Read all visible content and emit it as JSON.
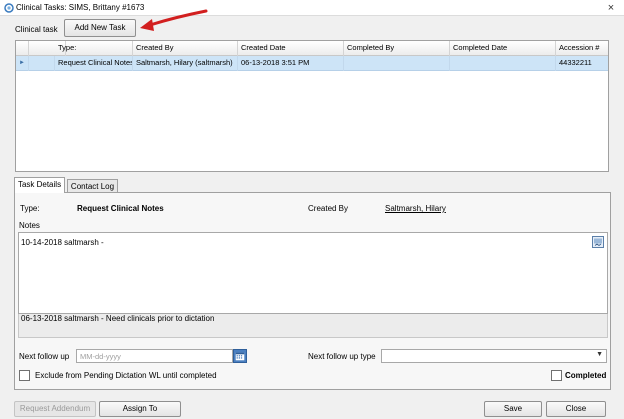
{
  "window": {
    "title": "Clinical Tasks: SIMS,  Brittany #1673",
    "close_glyph": "×"
  },
  "header": {
    "clinical_task_label": "Clinical task",
    "add_task_label": "Add New Task"
  },
  "grid": {
    "columns": [
      "",
      "Type:",
      "Created By",
      "Created Date",
      "Completed By",
      "Completed Date",
      "Accession #"
    ],
    "rows": [
      {
        "indicator": "►",
        "type": "Request Clinical Notes",
        "created_by": "Saltmarsh, Hilary (saltmarsh)",
        "created_date": "06-13-2018 3:51 PM",
        "completed_by": "",
        "completed_date": "",
        "accession": "44332211"
      }
    ]
  },
  "tabs": [
    "Task Details",
    "Contact Log"
  ],
  "details": {
    "type_label": "Type:",
    "type_value": "Request Clinical Notes",
    "created_by_label": "Created By",
    "created_by_value": "Saltmarsh, Hilary",
    "notes_label": "Notes",
    "note_current": "10-14-2018 saltmarsh -",
    "note_history": "06-13-2018 saltmarsh - Need clinicals prior to dictation",
    "next_followup_label": "Next follow up",
    "next_followup_placeholder": "MM-dd-yyyy",
    "next_followup_type_label": "Next follow up type",
    "exclude_label": "Exclude from Pending Dictation WL until completed",
    "completed_label": "Completed"
  },
  "buttons": {
    "request_addendum": "Request Addendum",
    "assign_to": "Assign To",
    "save": "Save",
    "close": "Close"
  },
  "colors": {
    "selected_row": "#cde4f7",
    "arrow": "#d21f1f",
    "calendar": "#4a7fc0"
  }
}
